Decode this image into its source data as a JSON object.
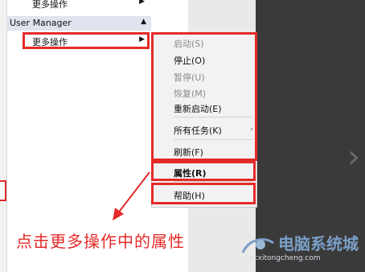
{
  "actions_panel": {
    "top_item_label": "更多操作",
    "section_title": "User Manager",
    "more_actions_label": "更多操作"
  },
  "context_menu": {
    "items": [
      {
        "label": "启动(S)",
        "enabled": false
      },
      {
        "label": "停止(O)",
        "enabled": true
      },
      {
        "label": "暂停(U)",
        "enabled": false
      },
      {
        "label": "恢复(M)",
        "enabled": false
      },
      {
        "label": "重新启动(E)",
        "enabled": true
      },
      {
        "label": "所有任务(K)",
        "enabled": true
      },
      {
        "label": "刷新(F)",
        "enabled": true
      },
      {
        "label": "属性(R)",
        "enabled": true
      },
      {
        "label": "帮助(H)",
        "enabled": true
      }
    ]
  },
  "annotation": {
    "text": "点击更多操作中的属性",
    "color": "#e52a2a"
  },
  "watermark": {
    "title": "电脑系统城",
    "url": "pcxitongcheng.com"
  },
  "icons": [
    "submenu-arrow-icon",
    "collapse-arrow-icon",
    "chevron-right-icon",
    "watermark-logo-icon"
  ]
}
